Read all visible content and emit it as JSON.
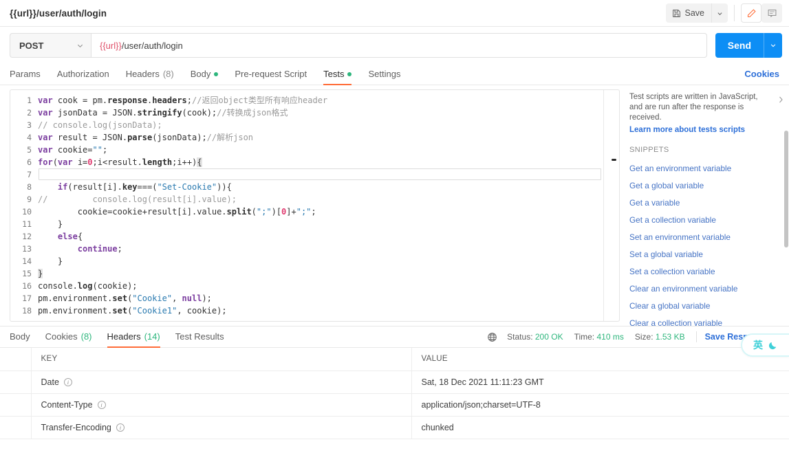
{
  "topbar": {
    "request_title": "{{url}}/user/auth/login",
    "save_label": "Save",
    "save_icon": "floppy-disk-icon",
    "save_caret_icon": "chevron-down-icon",
    "edit_icon": "pencil-icon",
    "comment_icon": "comment-icon"
  },
  "urlbar": {
    "method": "POST",
    "method_caret_icon": "chevron-down-icon",
    "url_variable": "{{url}}",
    "url_path": "/user/auth/login",
    "url_full": "{{url}}/user/auth/login",
    "send_label": "Send",
    "send_caret_icon": "chevron-down-icon"
  },
  "request_tabs": {
    "items": [
      {
        "label": "Params",
        "count": "",
        "dot": false,
        "active": false
      },
      {
        "label": "Authorization",
        "count": "",
        "dot": false,
        "active": false
      },
      {
        "label": "Headers",
        "count": "(8)",
        "dot": false,
        "active": false
      },
      {
        "label": "Body",
        "count": "",
        "dot": true,
        "active": false
      },
      {
        "label": "Pre-request Script",
        "count": "",
        "dot": false,
        "active": false
      },
      {
        "label": "Tests",
        "count": "",
        "dot": true,
        "active": true
      },
      {
        "label": "Settings",
        "count": "",
        "dot": false,
        "active": false
      }
    ],
    "cookies_link": "Cookies"
  },
  "editor": {
    "lines": [
      {
        "n": "1",
        "text": "var cook = pm.response.headers;//返回object类型所有响应header"
      },
      {
        "n": "2",
        "text": "var jsonData = JSON.stringify(cook);//转换成json格式"
      },
      {
        "n": "3",
        "text": "// console.log(jsonData);"
      },
      {
        "n": "4",
        "text": "var result = JSON.parse(jsonData);//解析json"
      },
      {
        "n": "5",
        "text": "var cookie=\"\";"
      },
      {
        "n": "6",
        "text": "for(var i=0;i<result.length;i++){"
      },
      {
        "n": "7",
        "text": ""
      },
      {
        "n": "8",
        "text": "    if(result[i].key===(\"Set-Cookie\")){"
      },
      {
        "n": "9",
        "text": "//         console.log(result[i].value);"
      },
      {
        "n": "10",
        "text": "        cookie=cookie+result[i].value.split(\";\")[0]+\";\";"
      },
      {
        "n": "11",
        "text": "    }"
      },
      {
        "n": "12",
        "text": "    else{"
      },
      {
        "n": "13",
        "text": "        continue;"
      },
      {
        "n": "14",
        "text": "    }"
      },
      {
        "n": "15",
        "text": "}"
      },
      {
        "n": "16",
        "text": "console.log(cookie);"
      },
      {
        "n": "17",
        "text": "pm.environment.set(\"Cookie\", null);"
      },
      {
        "n": "18",
        "text": "pm.environment.set(\"Cookie1\", cookie);"
      }
    ],
    "active_line": "7"
  },
  "snippets": {
    "description": "Test scripts are written in JavaScript, and are run after the response is received.",
    "learn_more": "Learn more about tests scripts",
    "heading": "SNIPPETS",
    "collapse_icon": "chevron-right-icon",
    "items": [
      "Get an environment variable",
      "Get a global variable",
      "Get a variable",
      "Get a collection variable",
      "Set an environment variable",
      "Set a global variable",
      "Set a collection variable",
      "Clear an environment variable",
      "Clear a global variable",
      "Clear a collection variable"
    ]
  },
  "ime_widget": {
    "mode": "英",
    "icon": "moon-icon"
  },
  "response": {
    "tabs": [
      {
        "label": "Body",
        "count": "",
        "active": false
      },
      {
        "label": "Cookies",
        "count": "(8)",
        "active": false
      },
      {
        "label": "Headers",
        "count": "(14)",
        "active": true
      },
      {
        "label": "Test Results",
        "count": "",
        "active": false
      }
    ],
    "globe_icon": "globe-icon",
    "status_label": "Status:",
    "status_value": "200 OK",
    "time_label": "Time:",
    "time_value": "410 ms",
    "size_label": "Size:",
    "size_value": "1.53 KB",
    "save_response_label": "Save Response",
    "save_response_caret_icon": "chevron-down-icon",
    "headers_table": {
      "columns": [
        "KEY",
        "VALUE"
      ],
      "rows": [
        {
          "key": "Date",
          "info_icon": "info-icon",
          "value": "Sat, 18 Dec 2021 11:11:23 GMT"
        },
        {
          "key": "Content-Type",
          "info_icon": "info-icon",
          "value": "application/json;charset=UTF-8"
        },
        {
          "key": "Transfer-Encoding",
          "info_icon": "info-icon",
          "value": "chunked"
        }
      ]
    }
  },
  "colors": {
    "accent_orange": "#ff6c37",
    "send_blue": "#0d8ef5",
    "link_blue": "#2d6fd8",
    "green": "#2eb67d",
    "var_pink": "#e0526b",
    "ime_cyan": "#3fd0d8"
  }
}
